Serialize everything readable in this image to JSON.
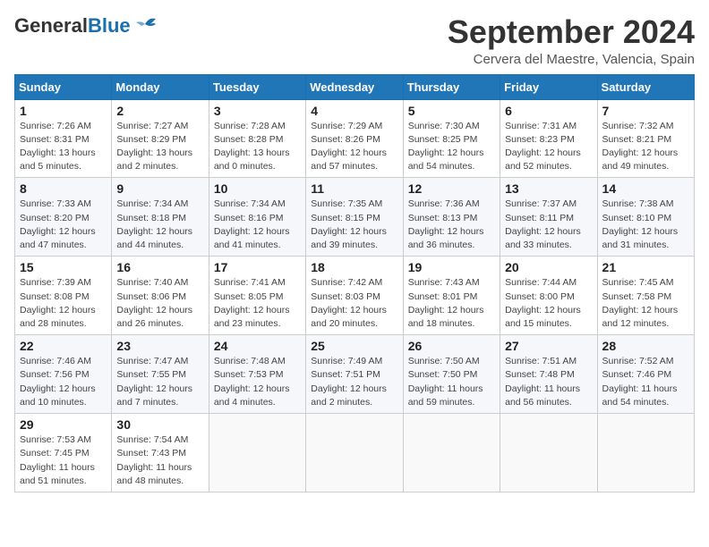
{
  "header": {
    "logo_general": "General",
    "logo_blue": "Blue",
    "month": "September 2024",
    "location": "Cervera del Maestre, Valencia, Spain"
  },
  "weekdays": [
    "Sunday",
    "Monday",
    "Tuesday",
    "Wednesday",
    "Thursday",
    "Friday",
    "Saturday"
  ],
  "weeks": [
    [
      {
        "day": "1",
        "sunrise": "Sunrise: 7:26 AM",
        "sunset": "Sunset: 8:31 PM",
        "daylight": "Daylight: 13 hours and 5 minutes."
      },
      {
        "day": "2",
        "sunrise": "Sunrise: 7:27 AM",
        "sunset": "Sunset: 8:29 PM",
        "daylight": "Daylight: 13 hours and 2 minutes."
      },
      {
        "day": "3",
        "sunrise": "Sunrise: 7:28 AM",
        "sunset": "Sunset: 8:28 PM",
        "daylight": "Daylight: 13 hours and 0 minutes."
      },
      {
        "day": "4",
        "sunrise": "Sunrise: 7:29 AM",
        "sunset": "Sunset: 8:26 PM",
        "daylight": "Daylight: 12 hours and 57 minutes."
      },
      {
        "day": "5",
        "sunrise": "Sunrise: 7:30 AM",
        "sunset": "Sunset: 8:25 PM",
        "daylight": "Daylight: 12 hours and 54 minutes."
      },
      {
        "day": "6",
        "sunrise": "Sunrise: 7:31 AM",
        "sunset": "Sunset: 8:23 PM",
        "daylight": "Daylight: 12 hours and 52 minutes."
      },
      {
        "day": "7",
        "sunrise": "Sunrise: 7:32 AM",
        "sunset": "Sunset: 8:21 PM",
        "daylight": "Daylight: 12 hours and 49 minutes."
      }
    ],
    [
      {
        "day": "8",
        "sunrise": "Sunrise: 7:33 AM",
        "sunset": "Sunset: 8:20 PM",
        "daylight": "Daylight: 12 hours and 47 minutes."
      },
      {
        "day": "9",
        "sunrise": "Sunrise: 7:34 AM",
        "sunset": "Sunset: 8:18 PM",
        "daylight": "Daylight: 12 hours and 44 minutes."
      },
      {
        "day": "10",
        "sunrise": "Sunrise: 7:34 AM",
        "sunset": "Sunset: 8:16 PM",
        "daylight": "Daylight: 12 hours and 41 minutes."
      },
      {
        "day": "11",
        "sunrise": "Sunrise: 7:35 AM",
        "sunset": "Sunset: 8:15 PM",
        "daylight": "Daylight: 12 hours and 39 minutes."
      },
      {
        "day": "12",
        "sunrise": "Sunrise: 7:36 AM",
        "sunset": "Sunset: 8:13 PM",
        "daylight": "Daylight: 12 hours and 36 minutes."
      },
      {
        "day": "13",
        "sunrise": "Sunrise: 7:37 AM",
        "sunset": "Sunset: 8:11 PM",
        "daylight": "Daylight: 12 hours and 33 minutes."
      },
      {
        "day": "14",
        "sunrise": "Sunrise: 7:38 AM",
        "sunset": "Sunset: 8:10 PM",
        "daylight": "Daylight: 12 hours and 31 minutes."
      }
    ],
    [
      {
        "day": "15",
        "sunrise": "Sunrise: 7:39 AM",
        "sunset": "Sunset: 8:08 PM",
        "daylight": "Daylight: 12 hours and 28 minutes."
      },
      {
        "day": "16",
        "sunrise": "Sunrise: 7:40 AM",
        "sunset": "Sunset: 8:06 PM",
        "daylight": "Daylight: 12 hours and 26 minutes."
      },
      {
        "day": "17",
        "sunrise": "Sunrise: 7:41 AM",
        "sunset": "Sunset: 8:05 PM",
        "daylight": "Daylight: 12 hours and 23 minutes."
      },
      {
        "day": "18",
        "sunrise": "Sunrise: 7:42 AM",
        "sunset": "Sunset: 8:03 PM",
        "daylight": "Daylight: 12 hours and 20 minutes."
      },
      {
        "day": "19",
        "sunrise": "Sunrise: 7:43 AM",
        "sunset": "Sunset: 8:01 PM",
        "daylight": "Daylight: 12 hours and 18 minutes."
      },
      {
        "day": "20",
        "sunrise": "Sunrise: 7:44 AM",
        "sunset": "Sunset: 8:00 PM",
        "daylight": "Daylight: 12 hours and 15 minutes."
      },
      {
        "day": "21",
        "sunrise": "Sunrise: 7:45 AM",
        "sunset": "Sunset: 7:58 PM",
        "daylight": "Daylight: 12 hours and 12 minutes."
      }
    ],
    [
      {
        "day": "22",
        "sunrise": "Sunrise: 7:46 AM",
        "sunset": "Sunset: 7:56 PM",
        "daylight": "Daylight: 12 hours and 10 minutes."
      },
      {
        "day": "23",
        "sunrise": "Sunrise: 7:47 AM",
        "sunset": "Sunset: 7:55 PM",
        "daylight": "Daylight: 12 hours and 7 minutes."
      },
      {
        "day": "24",
        "sunrise": "Sunrise: 7:48 AM",
        "sunset": "Sunset: 7:53 PM",
        "daylight": "Daylight: 12 hours and 4 minutes."
      },
      {
        "day": "25",
        "sunrise": "Sunrise: 7:49 AM",
        "sunset": "Sunset: 7:51 PM",
        "daylight": "Daylight: 12 hours and 2 minutes."
      },
      {
        "day": "26",
        "sunrise": "Sunrise: 7:50 AM",
        "sunset": "Sunset: 7:50 PM",
        "daylight": "Daylight: 11 hours and 59 minutes."
      },
      {
        "day": "27",
        "sunrise": "Sunrise: 7:51 AM",
        "sunset": "Sunset: 7:48 PM",
        "daylight": "Daylight: 11 hours and 56 minutes."
      },
      {
        "day": "28",
        "sunrise": "Sunrise: 7:52 AM",
        "sunset": "Sunset: 7:46 PM",
        "daylight": "Daylight: 11 hours and 54 minutes."
      }
    ],
    [
      {
        "day": "29",
        "sunrise": "Sunrise: 7:53 AM",
        "sunset": "Sunset: 7:45 PM",
        "daylight": "Daylight: 11 hours and 51 minutes."
      },
      {
        "day": "30",
        "sunrise": "Sunrise: 7:54 AM",
        "sunset": "Sunset: 7:43 PM",
        "daylight": "Daylight: 11 hours and 48 minutes."
      },
      null,
      null,
      null,
      null,
      null
    ]
  ]
}
